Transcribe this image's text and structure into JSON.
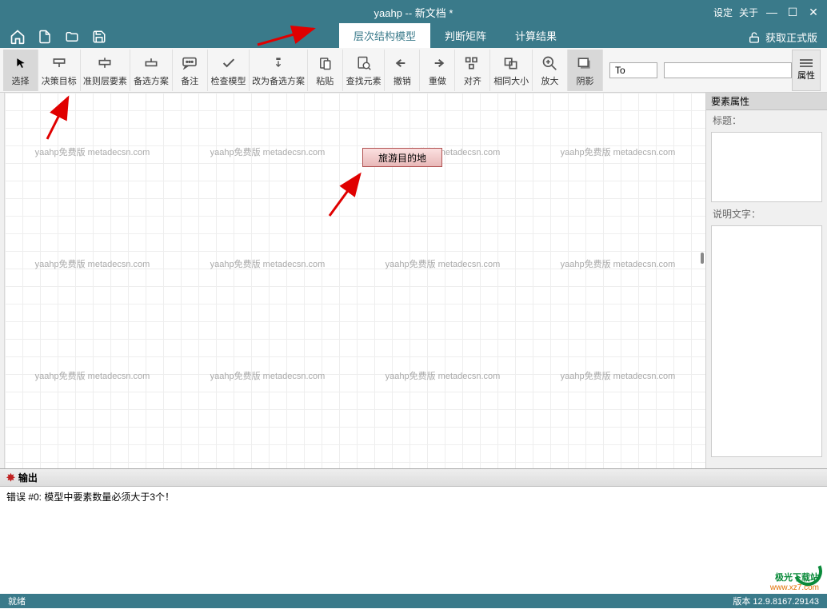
{
  "titlebar": {
    "title": "yaahp -- 新文档 *",
    "settings": "设定",
    "about": "关于"
  },
  "tabs": {
    "t1": "层次结构模型",
    "t2": "判断矩阵",
    "t3": "计算结果"
  },
  "menubar": {
    "get_full": "获取正式版"
  },
  "toolbar": {
    "select": "选择",
    "goal": "决策目标",
    "criteria": "准则层要素",
    "alternative": "备选方案",
    "note": "备注",
    "check": "检查模型",
    "toalt": "改为备选方案",
    "paste": "粘贴",
    "find": "查找元素",
    "undo": "撤销",
    "redo": "重做",
    "align": "对齐",
    "samesize": "相同大小",
    "zoom": "放大",
    "shadow": "阴影",
    "input_to": "To",
    "properties": "属性"
  },
  "canvas": {
    "node_text": "旅游目的地",
    "watermark": "yaahp免费版 metadecsn.com"
  },
  "prop_panel": {
    "header": "要素属性",
    "title_label": "标题：",
    "desc_label": "说明文字："
  },
  "output": {
    "header": "输出",
    "error_line": "错误 #0:    模型中要素数量必须大于3个！"
  },
  "statusbar": {
    "status": "就绪",
    "version": "版本 12.9.8167.29143"
  },
  "site": {
    "name": "极光下载站",
    "url": "www.xz7.com"
  }
}
